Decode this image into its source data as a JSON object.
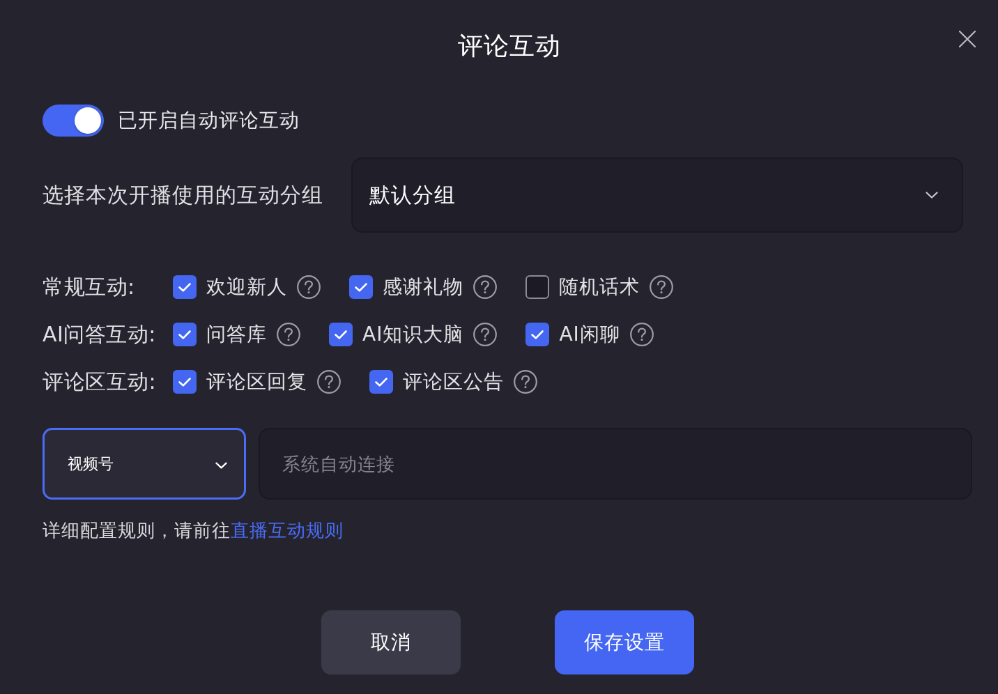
{
  "dialog": {
    "title": "评论互动"
  },
  "auto_reply": {
    "label": "已开启自动评论互动",
    "on": true
  },
  "group": {
    "label": "选择本次开播使用的互动分组",
    "value": "默认分组"
  },
  "interaction_groups": [
    {
      "label": "常规互动:",
      "options": [
        {
          "label": "欢迎新人",
          "checked": true
        },
        {
          "label": "感谢礼物",
          "checked": true
        },
        {
          "label": "随机话术",
          "checked": false
        }
      ]
    },
    {
      "label": "AI问答互动:",
      "options": [
        {
          "label": "问答库",
          "checked": true
        },
        {
          "label": "AI知识大脑",
          "checked": true
        },
        {
          "label": "AI闲聊",
          "checked": true
        }
      ]
    },
    {
      "label": "评论区互动:",
      "options": [
        {
          "label": "评论区回复",
          "checked": true
        },
        {
          "label": "评论区公告",
          "checked": true
        }
      ]
    }
  ],
  "platform": {
    "value": "视频号",
    "focused": true,
    "placeholder": "系统自动连接"
  },
  "note": {
    "text": "详细配置规则，请前往",
    "link": "直播互动规则"
  },
  "buttons": [
    {
      "label": "取消",
      "kind": "secondary"
    },
    {
      "label": "保存设置",
      "kind": "primary"
    }
  ]
}
